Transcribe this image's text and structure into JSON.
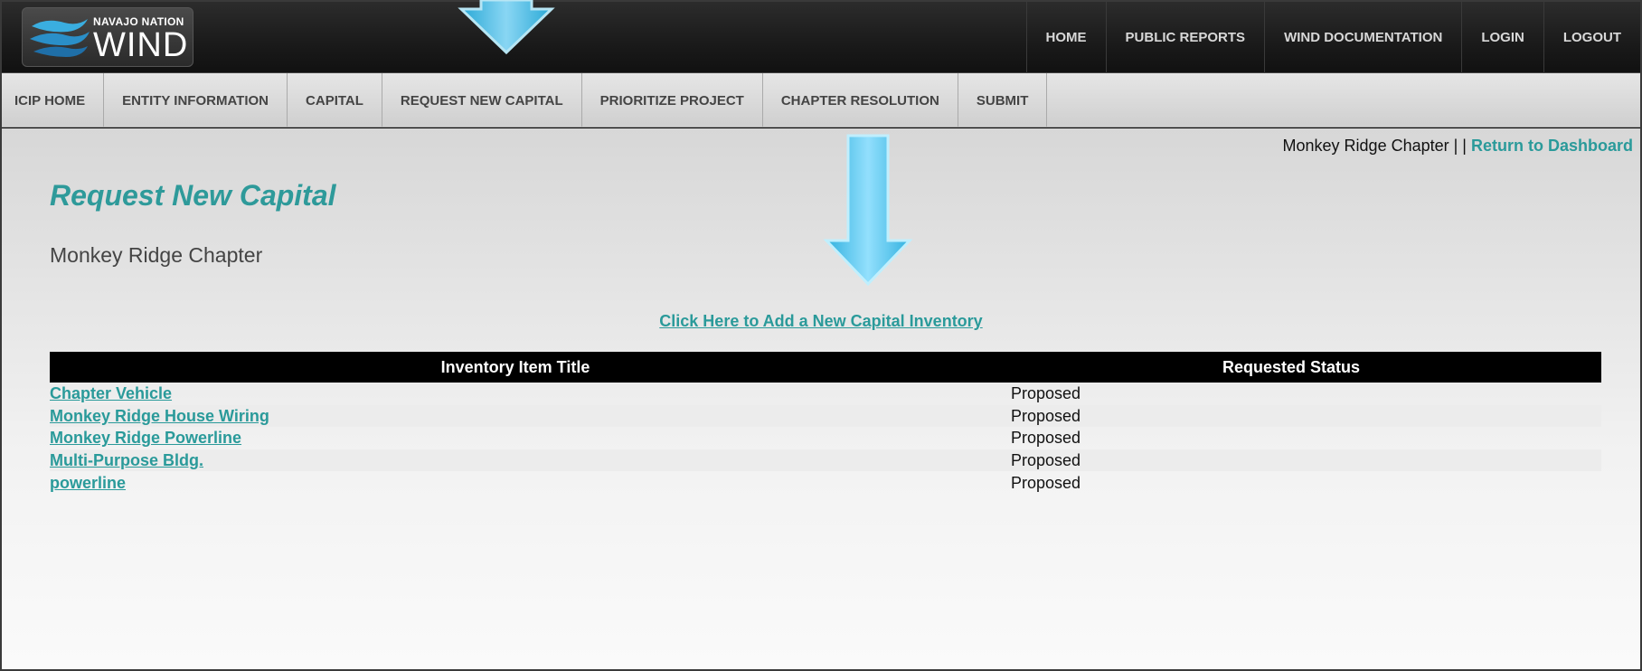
{
  "logo": {
    "top_text": "NAVAJO NATION",
    "main_text": "WIND"
  },
  "topnav": [
    {
      "label": "HOME"
    },
    {
      "label": "PUBLIC REPORTS"
    },
    {
      "label": "WIND DOCUMENTATION"
    },
    {
      "label": "LOGIN"
    },
    {
      "label": "LOGOUT"
    }
  ],
  "subnav": [
    {
      "label": "ICIP HOME"
    },
    {
      "label": "ENTITY INFORMATION"
    },
    {
      "label": "CAPITAL"
    },
    {
      "label": "REQUEST NEW CAPITAL"
    },
    {
      "label": "PRIORITIZE PROJECT"
    },
    {
      "label": "CHAPTER RESOLUTION"
    },
    {
      "label": "SUBMIT"
    }
  ],
  "header": {
    "chapter_name": "Monkey Ridge Chapter",
    "separator": " | | ",
    "return_link": "Return to Dashboard"
  },
  "page": {
    "title": "Request New Capital",
    "subtitle": "Monkey Ridge Chapter",
    "add_link": "Click Here to Add a New Capital Inventory"
  },
  "table": {
    "columns": [
      "Inventory Item Title",
      "Requested Status"
    ],
    "rows": [
      {
        "title": "Chapter Vehicle",
        "status": "Proposed"
      },
      {
        "title": "Monkey Ridge House Wiring",
        "status": "Proposed"
      },
      {
        "title": "Monkey Ridge Powerline",
        "status": "Proposed"
      },
      {
        "title": "Multi-Purpose Bldg.",
        "status": "Proposed"
      },
      {
        "title": "powerline",
        "status": "Proposed"
      }
    ]
  },
  "colors": {
    "accent": "#2e9a9a",
    "arrow": "#4cc8ee"
  }
}
